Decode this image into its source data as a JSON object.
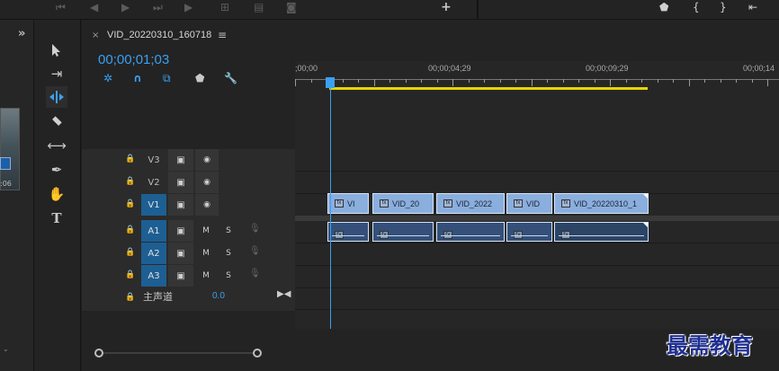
{
  "sequence": {
    "tab_title": "VID_20220310_160718",
    "timecode": "00;00;01;03"
  },
  "ruler": {
    "labels": [
      ";00;00",
      "00;00;04;29",
      "00;00;09;29",
      "00;00;14"
    ]
  },
  "video_tracks": [
    {
      "name": "V3",
      "selected": false
    },
    {
      "name": "V2",
      "selected": false
    },
    {
      "name": "V1",
      "selected": true
    }
  ],
  "audio_tracks": [
    {
      "name": "A1",
      "m": "M",
      "s": "S"
    },
    {
      "name": "A2",
      "m": "M",
      "s": "S"
    },
    {
      "name": "A3",
      "m": "M",
      "s": "S"
    }
  ],
  "master": {
    "label": "主声道",
    "value": "0.0"
  },
  "video_clips": [
    {
      "label": "VI"
    },
    {
      "label": "VID_20"
    },
    {
      "label": "VID_2022"
    },
    {
      "label": "VID"
    },
    {
      "label": "VID_20220310_1"
    }
  ],
  "left_panel": {
    "thumb_time": ":06"
  },
  "watermark": "最需教育",
  "colors": {
    "accent": "#3ba0f0",
    "work_area": "#e6d600",
    "video_clip": "#8aaedd",
    "audio_clip": "#34507a",
    "track_selected": "#1d5f93"
  }
}
